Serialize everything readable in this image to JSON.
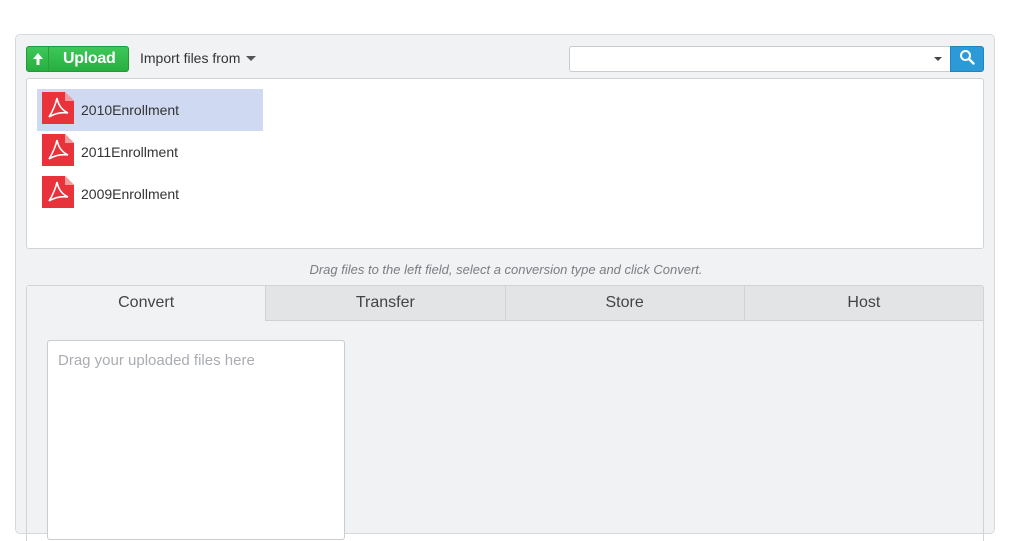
{
  "toolbar": {
    "upload_label": "Upload",
    "import_label": "Import files from",
    "search_value": ""
  },
  "files": [
    {
      "name": "2010Enrollment",
      "selected": true
    },
    {
      "name": "2011Enrollment",
      "selected": false
    },
    {
      "name": "2009Enrollment",
      "selected": false
    }
  ],
  "hint": "Drag files to the left field, select a conversion type and click Convert.",
  "tabs": [
    {
      "label": "Convert",
      "active": true
    },
    {
      "label": "Transfer",
      "active": false
    },
    {
      "label": "Store",
      "active": false
    },
    {
      "label": "Host",
      "active": false
    }
  ],
  "drop_zone": {
    "placeholder": "Drag your uploaded files here"
  },
  "colors": {
    "upload_green": "#2fb84a",
    "search_blue": "#2b9ad6",
    "pdf_red": "#e8333a",
    "selected_row": "#cfdaf2"
  },
  "icons": [
    "up-arrow-icon",
    "caret-down-icon",
    "search-icon",
    "pdf-icon"
  ]
}
